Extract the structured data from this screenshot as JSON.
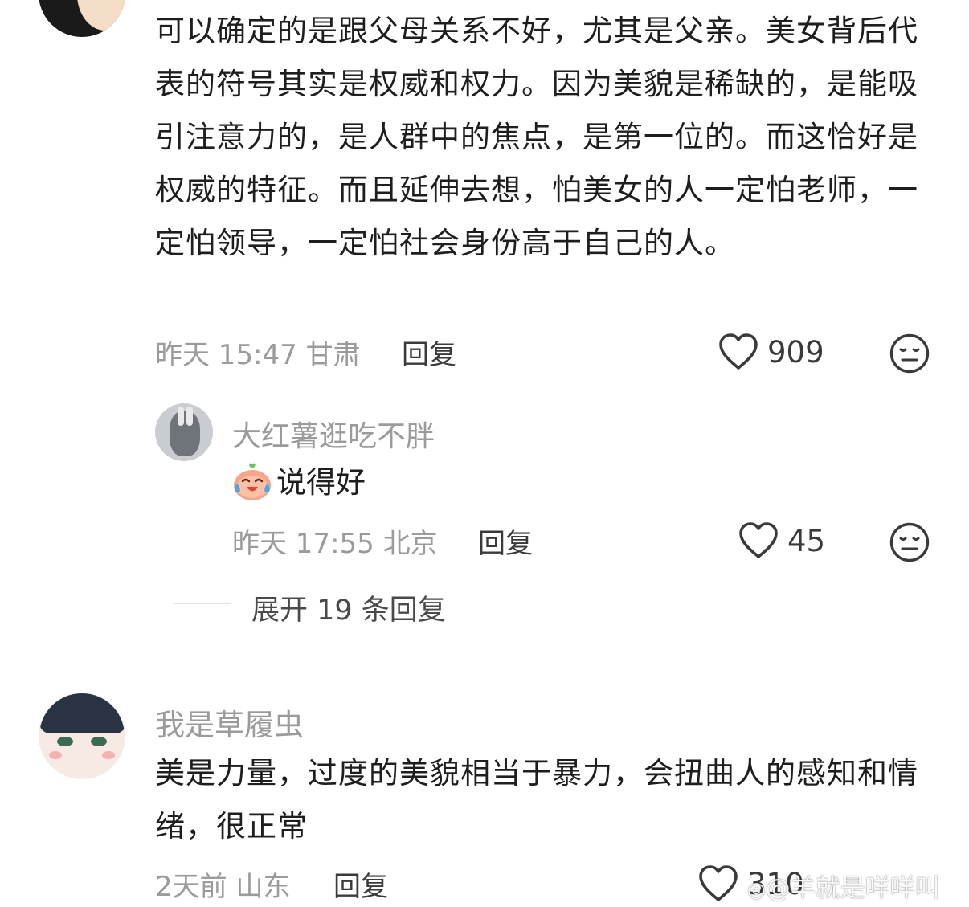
{
  "comments": [
    {
      "text": "可以确定的是跟父母关系不好，尤其是父亲。美女背后代表的符号其实是权威和权力。因为美貌是稀缺的，是能吸引注意力的，是人群中的焦点，是第一位的。而这恰好是权威的特征。而且延伸去想，怕美女的人一定怕老师，一定怕领导，一定怕社会身份高于自己的人。",
      "meta": "昨天 15:47 甘肃",
      "reply_label": "回复",
      "likes": "909",
      "reply": {
        "username": "大红薯逛吃不胖",
        "text": "说得好",
        "meta": "昨天 17:55 北京",
        "reply_label": "回复",
        "likes": "45"
      },
      "expand_label": "展开 19 条回复"
    },
    {
      "username": "我是草履虫",
      "text": "美是力量，过度的美貌相当于暴力，会扭曲人的感知和情绪，很正常",
      "meta": "2天前 山东",
      "reply_label": "回复",
      "likes": "310"
    }
  ],
  "watermark": "@羊就是咩咩叫",
  "icons": {
    "like": "heart-outline-icon",
    "dislike": "meh-face-icon",
    "emoji": "crying-laugh-emoji-icon"
  },
  "colors": {
    "text": "#1e1e1e",
    "meta": "#9b9b9b",
    "icon": "#3a3a3a"
  }
}
